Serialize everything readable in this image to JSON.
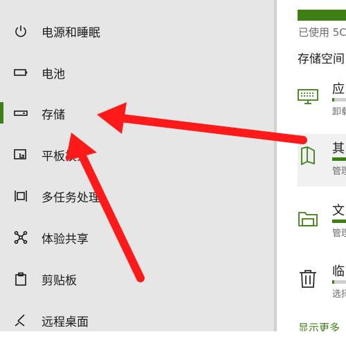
{
  "colors": {
    "accent": "#3d7f14",
    "arrow": "#ff1a1a",
    "sidebar_bg": "#e6e6e6"
  },
  "sidebar": {
    "items": [
      {
        "label": "电源和睡眠",
        "icon": "power-icon"
      },
      {
        "label": "电池",
        "icon": "battery-icon"
      },
      {
        "label": "存储",
        "icon": "storage-icon",
        "selected": true
      },
      {
        "label": "平板模式",
        "icon": "tablet-mode-icon"
      },
      {
        "label": "多任务处理",
        "icon": "multitasking-icon"
      },
      {
        "label": "体验共享",
        "icon": "share-icon"
      },
      {
        "label": "剪贴板",
        "icon": "clipboard-icon"
      },
      {
        "label": "远程桌面",
        "icon": "remote-desktop-icon"
      }
    ]
  },
  "storage": {
    "used_text": "已使用 5C",
    "heading": "存储空间",
    "categories": [
      {
        "name": "应",
        "sub": "卸载",
        "icon": "keyboard-icon",
        "fill_fraction": 0.05
      },
      {
        "name": "其",
        "sub": "管理",
        "icon": "document-icon",
        "fill_fraction": 1.0
      },
      {
        "name": "文",
        "sub": "管理",
        "icon": "folder-icon",
        "fill_fraction": 0.9
      },
      {
        "name": "临",
        "sub": "选择",
        "icon": "trash-icon",
        "fill_fraction": 0.05
      }
    ],
    "show_more": "显示更多"
  }
}
